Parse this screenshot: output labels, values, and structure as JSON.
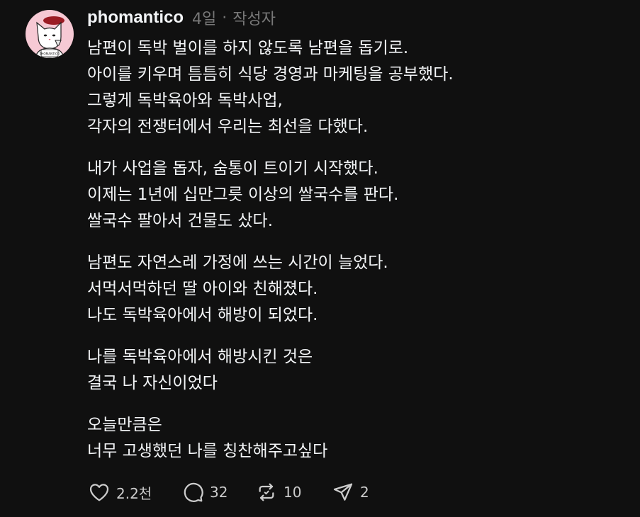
{
  "post": {
    "username": "phomantico",
    "time": "4일",
    "separator": "·",
    "author_tag": "작성자",
    "avatar_text": "PHOMANTICO",
    "paragraphs": [
      [
        "남편이 독박 벌이를 하지 않도록 남편을 돕기로.",
        "아이를 키우며 틈틈히 식당 경영과 마케팅을 공부했다.",
        "그렇게 독박육아와 독박사업,",
        "각자의 전쟁터에서 우리는 최선을 다했다."
      ],
      [
        "내가 사업을 돕자, 숨통이 트이기 시작했다.",
        "이제는 1년에 십만그릇 이상의 쌀국수를 판다.",
        "쌀국수 팔아서 건물도 샀다."
      ],
      [
        "남편도 자연스레 가정에 쓰는 시간이 늘었다.",
        "서먹서먹하던 딸 아이와 친해졌다.",
        "나도 독박육아에서 해방이 되었다."
      ],
      [
        "나를 독박육아에서 해방시킨 것은",
        "결국 나 자신이었다"
      ],
      [
        "오늘만큼은",
        "너무 고생했던 나를 칭찬해주고싶다"
      ]
    ]
  },
  "actions": {
    "like": {
      "icon": "heart-icon",
      "count": "2.2천"
    },
    "reply": {
      "icon": "comment-icon",
      "count": "32"
    },
    "repost": {
      "icon": "repost-icon",
      "count": "10"
    },
    "share": {
      "icon": "send-icon",
      "count": "2"
    }
  },
  "colors": {
    "background": "#101010",
    "text": "#f3f5f7",
    "muted": "#777777",
    "avatar_bg": "#f6c9d4"
  }
}
